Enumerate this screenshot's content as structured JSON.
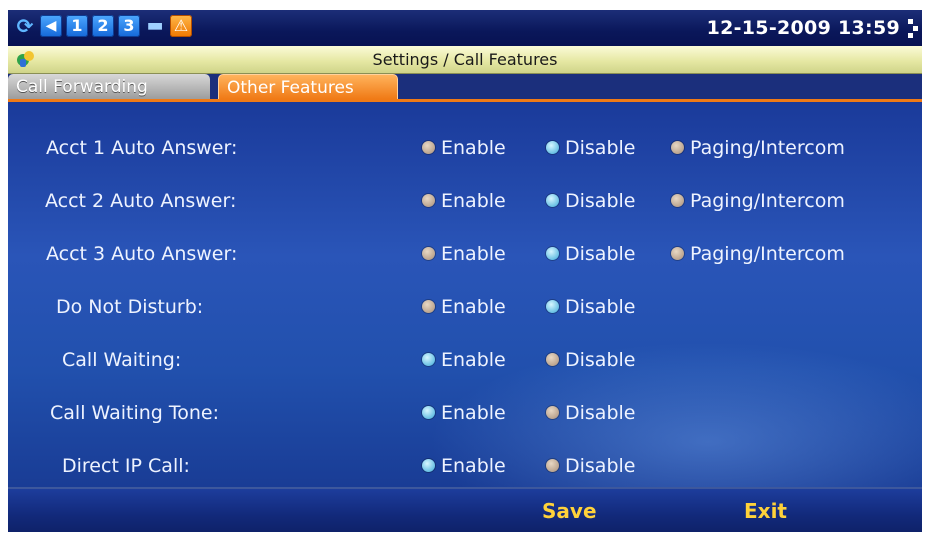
{
  "status_bar": {
    "icons": [
      "refresh-icon",
      "volume-icon",
      "line-1-icon",
      "line-2-icon",
      "line-3-icon",
      "folder-icon",
      "alert-icon"
    ],
    "line_numbers": [
      "1",
      "2",
      "3"
    ],
    "datetime": "12-15-2009 13:59"
  },
  "title_bar": {
    "title": "Settings / Call Features"
  },
  "tabs": [
    {
      "label": "Call Forwarding",
      "active": false
    },
    {
      "label": "Other Features",
      "active": true
    }
  ],
  "settings": [
    {
      "label": "Acct 1 Auto Answer:",
      "options": [
        {
          "label": "Enable",
          "selected": false
        },
        {
          "label": "Disable",
          "selected": true
        },
        {
          "label": "Paging/Intercom",
          "selected": false
        }
      ]
    },
    {
      "label": "Acct 2 Auto Answer:",
      "options": [
        {
          "label": "Enable",
          "selected": false
        },
        {
          "label": "Disable",
          "selected": true
        },
        {
          "label": "Paging/Intercom",
          "selected": false
        }
      ]
    },
    {
      "label": "Acct 3 Auto Answer:",
      "options": [
        {
          "label": "Enable",
          "selected": false
        },
        {
          "label": "Disable",
          "selected": true
        },
        {
          "label": "Paging/Intercom",
          "selected": false
        }
      ]
    },
    {
      "label": "Do Not Disturb:",
      "options": [
        {
          "label": "Enable",
          "selected": false
        },
        {
          "label": "Disable",
          "selected": true
        }
      ]
    },
    {
      "label": "Call Waiting:",
      "options": [
        {
          "label": "Enable",
          "selected": true
        },
        {
          "label": "Disable",
          "selected": false
        }
      ]
    },
    {
      "label": "Call Waiting Tone:",
      "options": [
        {
          "label": "Enable",
          "selected": true
        },
        {
          "label": "Disable",
          "selected": false
        }
      ]
    },
    {
      "label": "Direct IP Call:",
      "options": [
        {
          "label": "Enable",
          "selected": true
        },
        {
          "label": "Disable",
          "selected": false
        }
      ]
    }
  ],
  "softkeys": {
    "save": "Save",
    "exit": "Exit"
  },
  "colors": {
    "background": "#17307e",
    "active_tab": "#f07a16",
    "softkey_text": "#ffd23a",
    "radio_selected": "#3aa9d8",
    "radio_unselected": "#a88e78"
  }
}
